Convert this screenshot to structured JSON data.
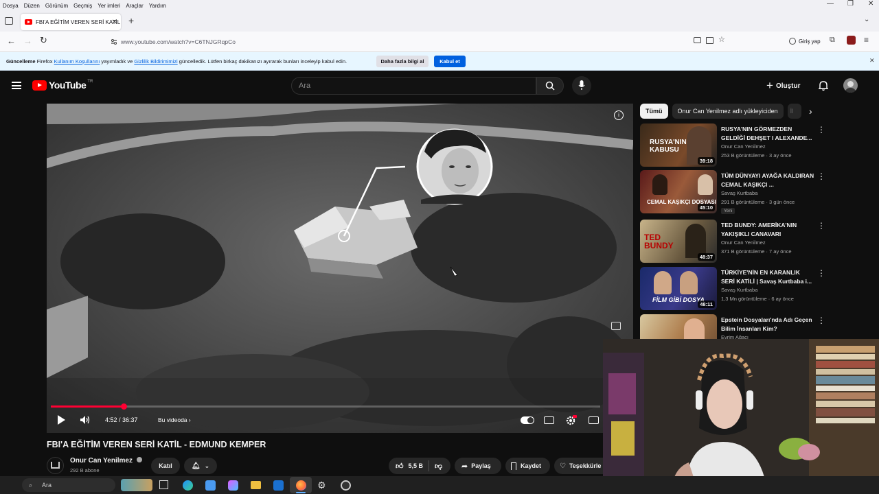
{
  "menu": {
    "items": [
      "Dosya",
      "Düzen",
      "Görünüm",
      "Geçmiş",
      "Yer imleri",
      "Araçlar",
      "Yardım"
    ]
  },
  "browser": {
    "tab_title": "FBI'A EĞİTİM VEREN SERİ KATİL",
    "url": "www.youtube.com/watch?v=C6TNJGRqpCo",
    "signin": "Giriş yap"
  },
  "notice": {
    "bold": "Güncelleme",
    "t1": " Firefox ",
    "link1": "Kullanım Koşullarını",
    "t2": " yayımladık ve ",
    "link2": "Gizlilik Bildirimimizi",
    "t3": " güncelledik. Lütfen birkaç dakikanızı ayırarak bunları inceleyip kabul edin.",
    "more": "Daha fazla bilgi al",
    "accept": "Kabul et"
  },
  "youtube": {
    "logo": "YouTube",
    "region": "TR",
    "search_placeholder": "Ara",
    "create": "Oluştur"
  },
  "player": {
    "time": "4:52 / 36:37",
    "chapter": "Bu videoda",
    "progress": 0.133
  },
  "video": {
    "title": "FBI'A EĞİTİM VEREN SERİ KATİL - EDMUND KEMPER",
    "channel": "Onur Can Yenilmez",
    "subs": "292 B abone",
    "join": "Katıl",
    "likes": "5,5 B",
    "share": "Paylaş",
    "save": "Kaydet",
    "thanks": "Teşekkürle"
  },
  "chips": [
    "Tümü",
    "Onur Can Yenilmez adlı yükleyiciden",
    "İl"
  ],
  "recommendations": [
    {
      "title": "RUSYA'NIN GÖRMEZDEN GELDİĞİ DEHŞET I ALEXANDE...",
      "channel": "Onur Can Yenilmez",
      "meta": "253 B görüntüleme · 3 ay önce",
      "duration": "39:18",
      "thumb_text": "RUSYA'NIN KABUSU",
      "badge": ""
    },
    {
      "title": "TÜM DÜNYAYI AYAĞA KALDIRAN CEMAL KAŞIKÇI ...",
      "channel": "Savaş Kurtbaba",
      "meta": "291 B görüntüleme · 3 gün önce",
      "duration": "45:10",
      "thumb_text": "CEMAL KAŞIKÇI DOSYASI",
      "badge": "Yeni"
    },
    {
      "title": "TED BUNDY: AMERİKA'NIN YAKIŞIKLI CANAVARI",
      "channel": "Onur Can Yenilmez",
      "meta": "371 B görüntüleme · 7 ay önce",
      "duration": "48:37",
      "thumb_text": "TED BUNDY",
      "badge": ""
    },
    {
      "title": "TÜRKİYE'NİN EN KARANLIK SERİ KATİLİ | Savaş Kurtbaba i...",
      "channel": "Savaş Kurtbaba",
      "meta": "1,3 Mn görüntüleme · 6 ay önce",
      "duration": "48:11",
      "thumb_text": "FİLM GİBİ DOSYA",
      "badge": ""
    },
    {
      "title": "Epstein Dosyaları'nda Adı Geçen Bilim İnsanları Kim?",
      "channel": "Evrim Ağacı",
      "meta": "",
      "duration": "",
      "thumb_text": "",
      "badge": ""
    }
  ],
  "taskbar": {
    "search": "Ara"
  }
}
